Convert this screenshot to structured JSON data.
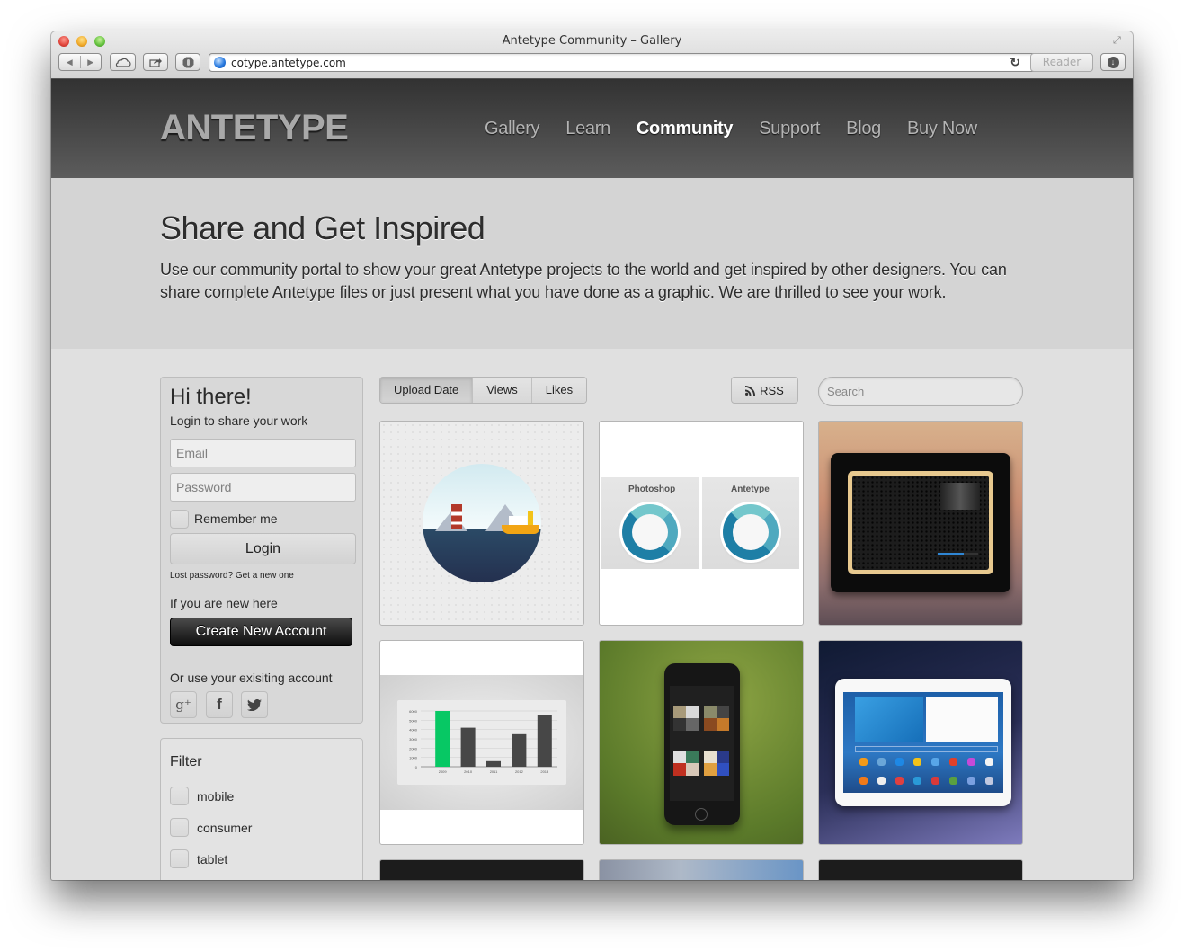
{
  "browser": {
    "window_title": "Antetype Community – Gallery",
    "url": "cotype.antetype.com",
    "reader_label": "Reader",
    "icons": {
      "back": "back-arrow-icon",
      "forward": "forward-arrow-icon",
      "icloud": "cloud-icon",
      "share": "share-icon",
      "privacy": "hand-stop-icon",
      "reload": "reload-icon",
      "download": "download-icon",
      "fullscreen": "fullscreen-icon"
    }
  },
  "header": {
    "logo": "ANTETYPE",
    "nav": [
      {
        "label": "Gallery",
        "active": false
      },
      {
        "label": "Learn",
        "active": false
      },
      {
        "label": "Community",
        "active": true
      },
      {
        "label": "Support",
        "active": false
      },
      {
        "label": "Blog",
        "active": false
      },
      {
        "label": "Buy Now",
        "active": false
      }
    ]
  },
  "hero": {
    "title": "Share and Get Inspired",
    "text": "Use our community portal to show your great Antetype projects to the world and get inspired by other designers. You can share complete Antetype files or just present what you have done as a graphic. We are thrilled to see your work."
  },
  "login": {
    "greeting": "Hi there!",
    "subtitle": "Login to share your work",
    "email_placeholder": "Email",
    "email_value": "",
    "password_placeholder": "Password",
    "password_value": "",
    "remember_label": "Remember me",
    "remember_checked": false,
    "login_button": "Login",
    "lost_password": "Lost password? Get a new one",
    "new_here": "If you are new here",
    "create_button": "Create New Account",
    "existing_label": "Or use your exisiting account",
    "social": [
      {
        "name": "google-plus",
        "glyph": "g⁺"
      },
      {
        "name": "facebook",
        "glyph": "f"
      },
      {
        "name": "twitter",
        "glyph": "twitter-bird"
      }
    ]
  },
  "filter": {
    "title": "Filter",
    "items": [
      {
        "label": "mobile",
        "checked": false
      },
      {
        "label": "consumer",
        "checked": false
      },
      {
        "label": "tablet",
        "checked": false
      }
    ]
  },
  "toolbar": {
    "sort_tabs": [
      {
        "label": "Upload Date",
        "active": true
      },
      {
        "label": "Views",
        "active": false
      },
      {
        "label": "Likes",
        "active": false
      }
    ],
    "rss_label": "RSS",
    "search_placeholder": "Search",
    "search_value": ""
  },
  "gallery": {
    "tiles": [
      {
        "name": "lighthouse-illustration"
      },
      {
        "name": "photoshop-vs-antetype-knobs",
        "captions": [
          "Photoshop",
          "Antetype"
        ]
      },
      {
        "name": "ipad-radio-app"
      },
      {
        "name": "bar-chart-design"
      },
      {
        "name": "iphone-music-app"
      },
      {
        "name": "samsung-galaxy-tab"
      },
      {
        "name": "dark-tile-partial"
      },
      {
        "name": "blue-gradient-tile-partial"
      },
      {
        "name": "dark-tile-partial-2"
      }
    ],
    "chart_thumb": {
      "categories": [
        "2009",
        "2010",
        "2011",
        "2012",
        "2013"
      ],
      "values": [
        6000,
        4200,
        600,
        3500,
        5600
      ],
      "y_ticks": [
        "0",
        "1000",
        "2000",
        "3000",
        "4000",
        "5000",
        "6000"
      ],
      "ymax": 6000,
      "highlight_color": "#07c864",
      "bar_color": "#474747"
    }
  }
}
